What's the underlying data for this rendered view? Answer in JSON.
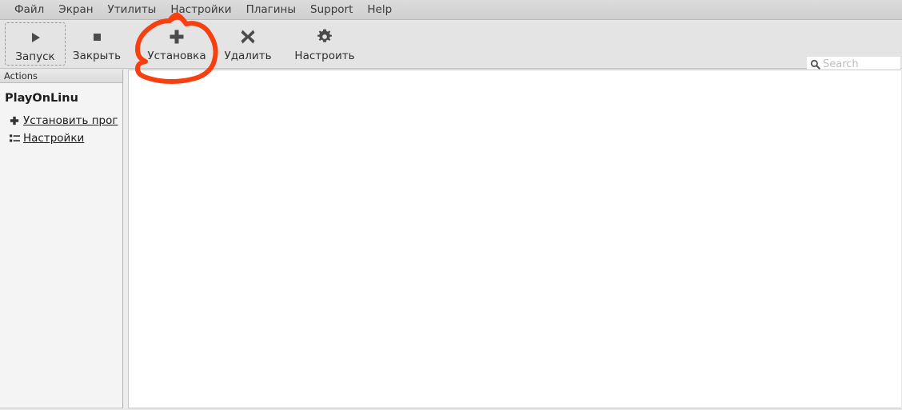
{
  "window": {
    "app_name": "PlayOnLinux"
  },
  "menubar": {
    "items": [
      {
        "label": "Файл"
      },
      {
        "label": "Экран"
      },
      {
        "label": "Утилиты"
      },
      {
        "label": "Настройки"
      },
      {
        "label": "Плагины"
      },
      {
        "label": "Support"
      },
      {
        "label": "Help"
      }
    ]
  },
  "toolbar": {
    "buttons": [
      {
        "label": "Запуск",
        "icon": "play-icon"
      },
      {
        "label": "Закрыть",
        "icon": "stop-icon"
      },
      {
        "label": "Установка",
        "icon": "plus-icon"
      },
      {
        "label": "Удалить",
        "icon": "close-x-icon"
      },
      {
        "label": "Настроить",
        "icon": "gear-icon"
      }
    ],
    "search": {
      "placeholder": "Search",
      "value": "",
      "icon": "search-icon"
    }
  },
  "sidebar": {
    "header": "Actions",
    "title": "PlayOnLinu",
    "links": [
      {
        "label": "Установить прог",
        "icon": "plus-icon"
      },
      {
        "label": "Настройки",
        "icon": "list-settings-icon"
      }
    ]
  },
  "main": {
    "program_list": [],
    "empty": true
  },
  "annotation": {
    "type": "hand-drawn-circle",
    "color": "#f73f10",
    "target": "Установка",
    "stroke_width": 6
  },
  "colors": {
    "menubar_bg": "#d4d4d4",
    "toolbar_bg": "#e4e4e4",
    "sidebar_bg": "#f4f4f4",
    "content_bg": "#ffffff",
    "annotation": "#f73f10",
    "icon": "#4b4b4b"
  }
}
